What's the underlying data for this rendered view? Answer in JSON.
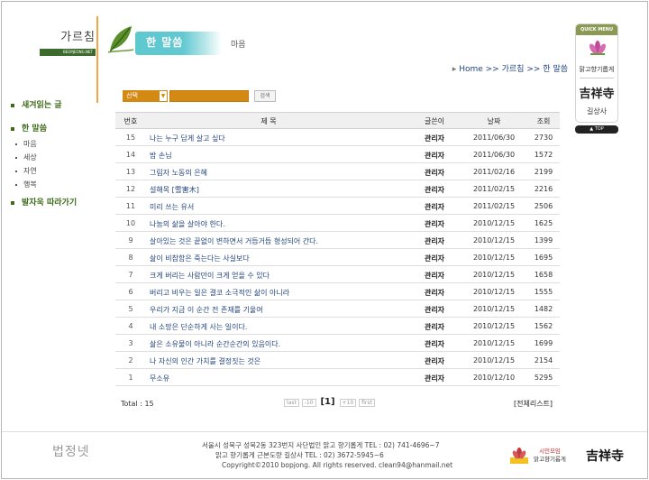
{
  "header": {
    "brand_title": "가르침",
    "brand_sub": "BEOPJEONG.NET",
    "banner_title": "한 말씀",
    "banner_sub": "마음"
  },
  "breadcrumb": {
    "home": "Home",
    "sep": ">>",
    "level1": "가르침",
    "level2": "한 말씀"
  },
  "quick_menu": {
    "head": "QUICK MENU",
    "item1": "맑고향기롭게",
    "item2_calligraphy": "吉祥寺",
    "item2": "길상사",
    "top": "▲ TOP"
  },
  "left_nav": {
    "item1": "새겨읽는 글",
    "item2": "한 말씀",
    "subs": [
      "마음",
      "세상",
      "자연",
      "행복"
    ],
    "item3": "발자욱 따라가기"
  },
  "search": {
    "select_value": "선택",
    "caret": "▼",
    "input_value": "",
    "button": "검색"
  },
  "table": {
    "headers": {
      "num": "번호",
      "title": "제 목",
      "writer": "글쓴이",
      "date": "날짜",
      "hits": "조회"
    },
    "rows": [
      {
        "num": "15",
        "title": "나는 누구 답게 살고 싶다",
        "writer": "관리자",
        "date": "2011/06/30",
        "hits": "2730"
      },
      {
        "num": "14",
        "title": "밤 손님",
        "writer": "관리자",
        "date": "2011/06/30",
        "hits": "1572"
      },
      {
        "num": "13",
        "title": "그림자 노동의 은혜",
        "writer": "관리자",
        "date": "2011/02/16",
        "hits": "2199"
      },
      {
        "num": "12",
        "title": "설해목 [雪害木]",
        "writer": "관리자",
        "date": "2011/02/15",
        "hits": "2216"
      },
      {
        "num": "11",
        "title": "미리 쓰는 유서",
        "writer": "관리자",
        "date": "2011/02/15",
        "hits": "2506"
      },
      {
        "num": "10",
        "title": "나눔의 삶을 살아야 한다.",
        "writer": "관리자",
        "date": "2010/12/15",
        "hits": "1625"
      },
      {
        "num": "9",
        "title": "살아있는 것은 끝없이 변하면서 거듭거듭 형성되어 간다.",
        "writer": "관리자",
        "date": "2010/12/15",
        "hits": "1399"
      },
      {
        "num": "8",
        "title": "삶이 비참함은 죽는다는 사실보다",
        "writer": "관리자",
        "date": "2010/12/15",
        "hits": "1695"
      },
      {
        "num": "7",
        "title": "크게 버리는 사람만이 크게 얻을 수 있다",
        "writer": "관리자",
        "date": "2010/12/15",
        "hits": "1658"
      },
      {
        "num": "6",
        "title": "버리고 비우는 일은 결코 소극적인 삶이 아니라",
        "writer": "관리자",
        "date": "2010/12/15",
        "hits": "1555"
      },
      {
        "num": "5",
        "title": "우리가 지금 이 순간 전 존재를 기울여",
        "writer": "관리자",
        "date": "2010/12/15",
        "hits": "1482"
      },
      {
        "num": "4",
        "title": "내 소망은 단순하게 사는 일이다.",
        "writer": "관리자",
        "date": "2010/12/15",
        "hits": "1562"
      },
      {
        "num": "3",
        "title": "삶은 소유물이 아니라 순간순간의 있음이다.",
        "writer": "관리자",
        "date": "2010/12/15",
        "hits": "1699"
      },
      {
        "num": "2",
        "title": "나 자신의 인간 가치를 결정짓는 것은",
        "writer": "관리자",
        "date": "2010/12/15",
        "hits": "2154"
      },
      {
        "num": "1",
        "title": "무소유",
        "writer": "관리자",
        "date": "2010/12/10",
        "hits": "5295"
      }
    ]
  },
  "pagination": {
    "total": "Total : 15",
    "first": "first",
    "prev10": "-10",
    "current": "[1]",
    "next10": "+10",
    "last": "last",
    "list_all": "[전체리스트]"
  },
  "footer": {
    "logo": "법정넷",
    "address1": "서울시 성북구 성북2동 323번지 사단법인 맑고 향기롭게 TEL : 02) 741-4696~7",
    "address2": "맑고 향기롭게 근본도량 길상사 TEL : 02) 3672-5945~6",
    "copyright": "Copyright©2010 bopjong. All rights reserved.   clean94@hanmail.net",
    "citizen_label_red": "시민모임",
    "citizen_label": "맑고향기롭게",
    "calligraphy": "吉祥寺"
  },
  "colors": {
    "accent_orange": "#d48a12",
    "link_blue": "#24467f",
    "nav_green": "#3d6b1a",
    "banner_teal": "#5ec8cf"
  }
}
